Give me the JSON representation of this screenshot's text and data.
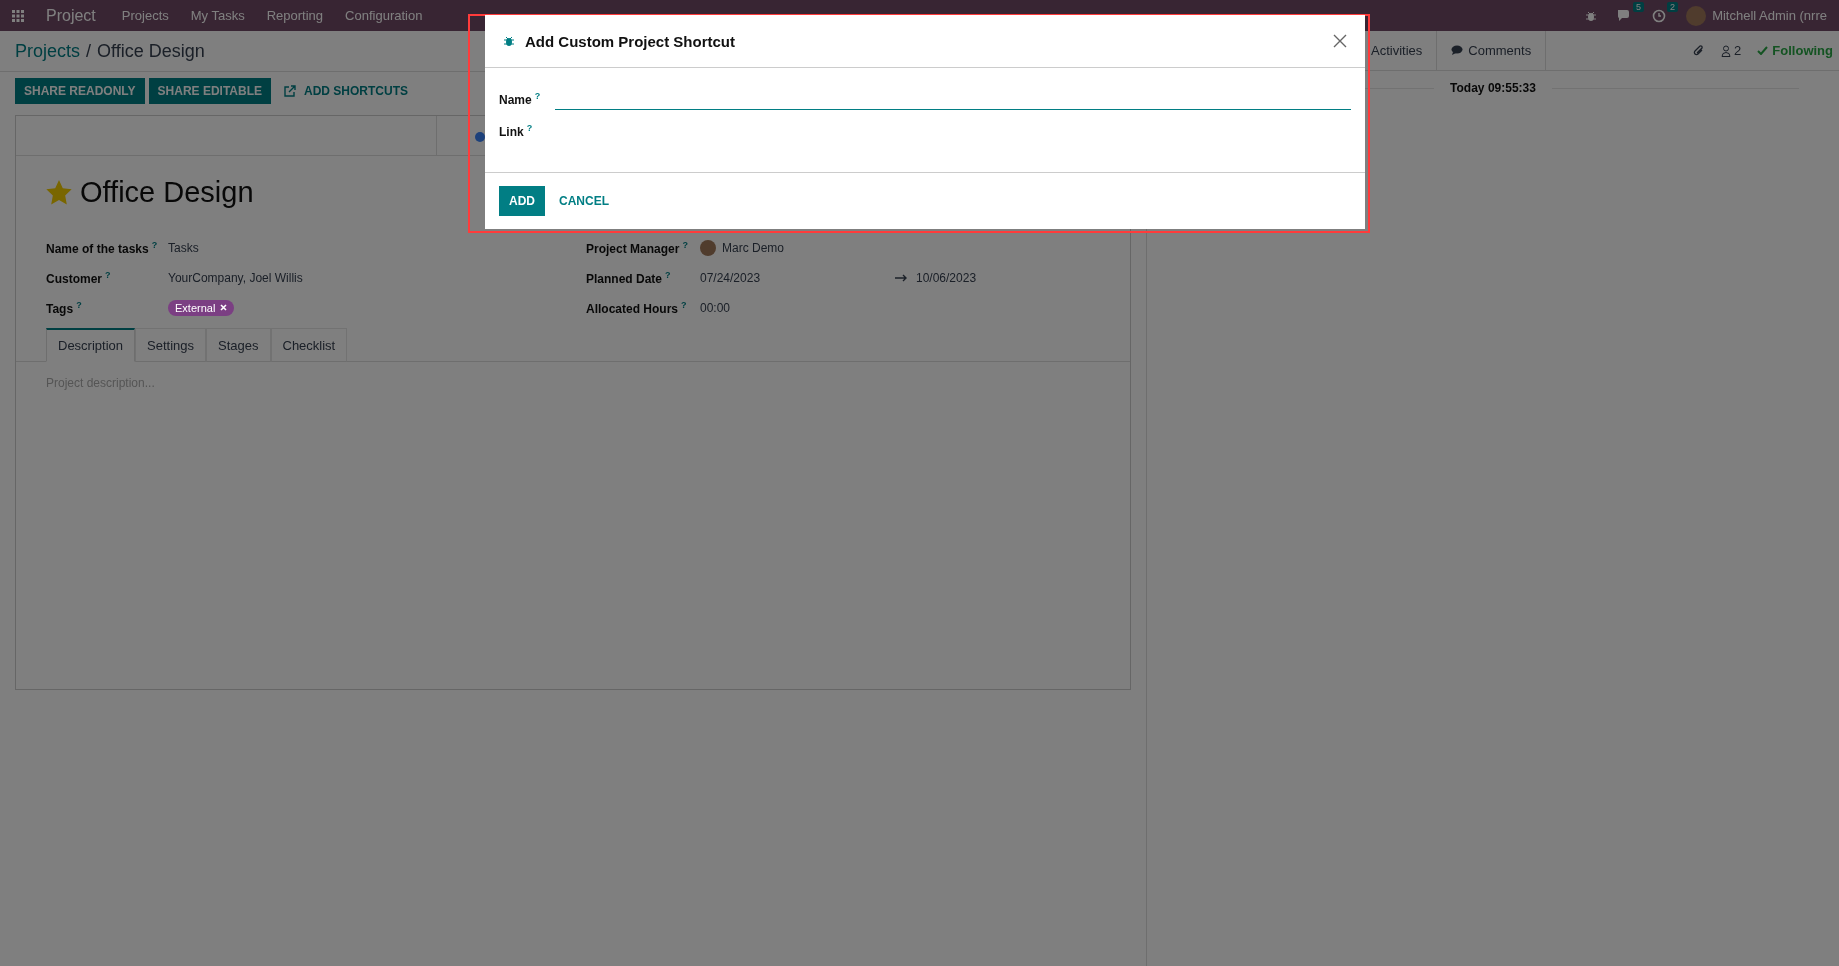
{
  "navbar": {
    "app": "Project",
    "menu": [
      "Projects",
      "My Tasks",
      "Reporting",
      "Configuration"
    ],
    "messages_badge": "5",
    "activities_badge": "2",
    "user": "Mitchell Admin (nrre"
  },
  "breadcrumb": [
    {
      "label": "Projects",
      "kind": "link"
    },
    {
      "label": "/",
      "kind": "separator"
    },
    {
      "label": "Office Design",
      "kind": "current"
    }
  ],
  "actions": [
    {
      "label": "SHARE READONLY",
      "kind": "primary"
    },
    {
      "label": "SHARE EDITABLE",
      "kind": "primary"
    },
    {
      "label": "ADD SHORTCUTS",
      "kind": "link"
    }
  ],
  "record": {
    "title": "Office Design",
    "starred": true,
    "left_fields": [
      {
        "label": "Name of the tasks",
        "help": "?",
        "value": "Tasks",
        "kind": "text"
      },
      {
        "label": "Customer",
        "help": "?",
        "value": "YourCompany, Joel Willis",
        "kind": "text"
      },
      {
        "label": "Tags",
        "help": "?",
        "value": "External",
        "kind": "tag",
        "color": "#7b3f83"
      }
    ],
    "right_fields": [
      {
        "label": "Project Manager",
        "help": "?",
        "value": "Marc Demo",
        "kind": "user"
      },
      {
        "label": "Planned Date",
        "help": "?",
        "value": "07/24/2023",
        "end": "10/06/2023",
        "kind": "range"
      },
      {
        "label": "Allocated Hours",
        "help": "?",
        "value": "00:00",
        "kind": "text"
      }
    ],
    "tabs": [
      {
        "label": "Description",
        "selected": true
      },
      {
        "label": "Settings",
        "selected": false
      },
      {
        "label": "Stages",
        "selected": false
      },
      {
        "label": "Checklist",
        "selected": false
      }
    ],
    "description_placeholder": "Project description..."
  },
  "chatter": {
    "buttons": [
      "Activities",
      "Comments"
    ],
    "followers": "2",
    "following": "Following",
    "date": "Today 09:55:33"
  },
  "dialog": {
    "title": "Add Custom Project Shortcut",
    "fields": [
      {
        "label": "Name",
        "help": "?",
        "kind": "input",
        "focused": true
      },
      {
        "label": "Link",
        "help": "?",
        "kind": "empty"
      }
    ],
    "buttons": [
      {
        "label": "ADD",
        "kind": "primary"
      },
      {
        "label": "CANCEL",
        "kind": "link"
      }
    ]
  }
}
